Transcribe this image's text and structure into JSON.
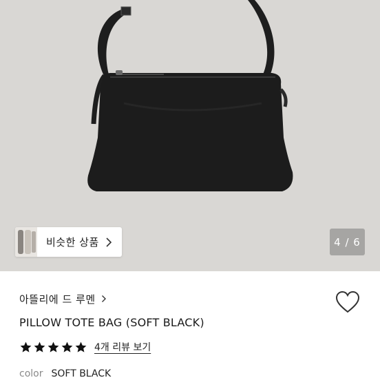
{
  "hero": {
    "similar_label": "비슷한 상품",
    "counter": "4 / 6"
  },
  "product": {
    "brand": "아뜰리에 드 루멘",
    "title": "PILLOW TOTE BAG (SOFT BLACK)",
    "rating": {
      "stars": 5,
      "max": 5,
      "review_link": "4개 리뷰 보기"
    },
    "color_label": "color",
    "color_value": "SOFT BLACK"
  },
  "icons": [
    "chevron-right-icon",
    "heart-icon",
    "star-icon"
  ],
  "colors": {
    "hero_bg": "#d9d7d4",
    "counter_bg": "#a6a5a3",
    "star": "#111111"
  }
}
